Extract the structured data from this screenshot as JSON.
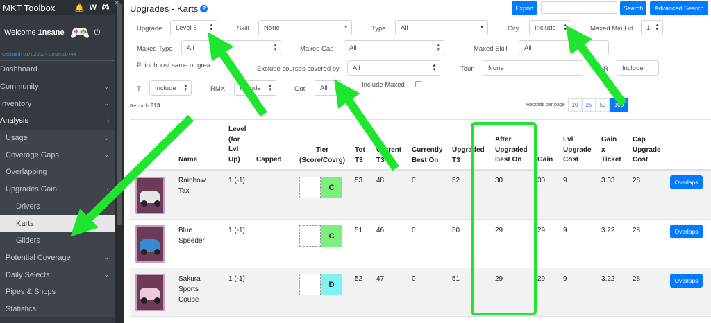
{
  "app": {
    "title": "MKT Toolbox"
  },
  "top_icons": {
    "bell": "🔔",
    "w": "W",
    "discord": "discord-icon"
  },
  "user": {
    "welcome": "Welcome",
    "name": "1nsane",
    "updated": "Updated: 01/10/2024 08:16:10 AM"
  },
  "nav": {
    "dashboard": "Dashboard",
    "community": "Community",
    "inventory": "Inventory",
    "analysis": "Analysis",
    "usage": "Usage",
    "coverage_gaps": "Coverage Gaps",
    "overlapping": "Overlapping",
    "upgrades_gain": "Upgrades Gain",
    "drivers": "Drivers",
    "karts": "Karts",
    "gliders": "Gliders",
    "potential_coverage": "Potential Coverage",
    "daily_selects": "Daily Selects",
    "pipes_shops": "Pipes & Shops",
    "statistics": "Statistics"
  },
  "page": {
    "title": "Upgrades - Karts"
  },
  "toolbar": {
    "export": "Export",
    "search": "Search",
    "advanced_search": "Advanced Search",
    "search_value": ""
  },
  "filters": {
    "upgrade": {
      "label": "Upgrade",
      "value": "Level 6"
    },
    "skill": {
      "label": "Skill",
      "value": "None"
    },
    "type": {
      "label": "Type",
      "value": "All"
    },
    "city": {
      "label": "City",
      "value": "Include"
    },
    "maxed_min_lvl": {
      "label": "Maxed Min Lvl",
      "value": "1"
    },
    "maxed_type": {
      "label": "Maxed Type",
      "value": "All"
    },
    "maxed_cap": {
      "label": "Maxed Cap",
      "value": "All"
    },
    "maxed_skill": {
      "label": "Maxed Skill",
      "value": "All"
    },
    "point_boost": {
      "label": "Point boost same or grea"
    },
    "exclude_courses": {
      "label": "Exclude courses covered by",
      "value": "All"
    },
    "tour": {
      "label": "Tour",
      "value": "None"
    },
    "r": {
      "label": "R",
      "value": "Include"
    },
    "t": {
      "label": "T",
      "value": "Include"
    },
    "rmx": {
      "label": "RMX",
      "value": "Include"
    },
    "got": {
      "label": "Got",
      "value": "All"
    },
    "include_maxed": {
      "label": "Include Maxed"
    }
  },
  "records": {
    "label": "Records",
    "count": "313",
    "per_page_label": "Records per page",
    "options": [
      "10",
      "25",
      "50",
      "100"
    ]
  },
  "table": {
    "headers": {
      "name": "Name",
      "level": [
        "Level",
        "(for",
        "Lvl",
        "Up)"
      ],
      "capped": "Capped",
      "tier": [
        "Tier",
        "(Score/Covrg)"
      ],
      "tot": [
        "Tot",
        "T3"
      ],
      "current": [
        "Current",
        "T3"
      ],
      "currently_best": [
        "Currently",
        "Best On"
      ],
      "upgraded": [
        "Upgraded",
        "T3"
      ],
      "after_upgraded": [
        "After",
        "Upgraded",
        "Best On"
      ],
      "gain": "Gain",
      "lvl_upgrade_cost": [
        "Lvl",
        "Upgrade",
        "Cost"
      ],
      "gain_ticket": [
        "Gain",
        "x",
        "Ticket"
      ],
      "cap_upgrade_cost": [
        "Cap",
        "Upgrade",
        "Cost"
      ]
    },
    "rows": [
      {
        "name": [
          "Rainbow",
          "Taxi"
        ],
        "level": "1 (-1)",
        "tier": "C",
        "tier_color": "#7cf07c",
        "tot": "53",
        "current": "48",
        "currently_best": "0",
        "upgraded": "52",
        "after": "30",
        "gain": "30",
        "lvl_cost": "9",
        "gain_ticket": "3.33",
        "cap_cost": "28",
        "action": "Overlaps",
        "kart_color": "#e6e6e6"
      },
      {
        "name": [
          "Blue",
          "Speeder"
        ],
        "level": "1 (-1)",
        "tier": "C",
        "tier_color": "#7cf07c",
        "tot": "51",
        "current": "46",
        "currently_best": "0",
        "upgraded": "50",
        "after": "29",
        "gain": "29",
        "lvl_cost": "9",
        "gain_ticket": "3.22",
        "cap_cost": "28",
        "action": "Overlaps",
        "kart_color": "#3a8ad0"
      },
      {
        "name": [
          "Sakura",
          "Sports",
          "Coupe"
        ],
        "level": "1 (-1)",
        "tier": "D",
        "tier_color": "#7ff2f2",
        "tot": "52",
        "current": "47",
        "currently_best": "0",
        "upgraded": "51",
        "after": "29",
        "gain": "29",
        "lvl_cost": "9",
        "gain_ticket": "3.22",
        "cap_cost": "28",
        "action": "Overlaps",
        "kart_color": "#f0c8dc"
      }
    ]
  },
  "annotations": {
    "arrow_color": "#1ee62e"
  }
}
